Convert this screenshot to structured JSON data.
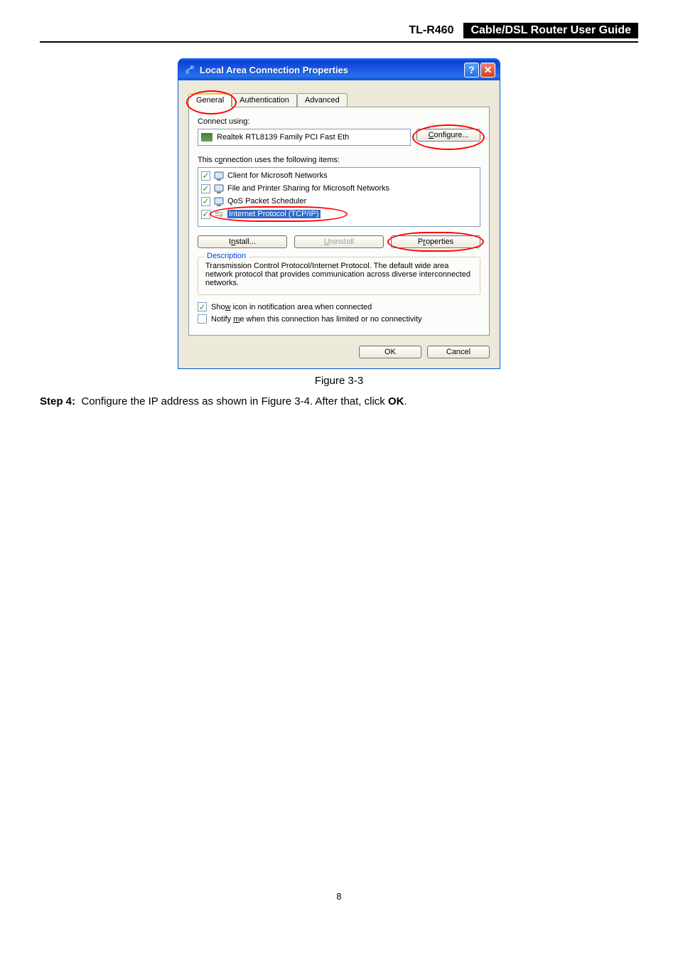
{
  "header": {
    "model": "TL-R460",
    "title": "Cable/DSL Router User Guide"
  },
  "dialog": {
    "title": "Local Area Connection Properties",
    "help_glyph": "?",
    "close_glyph": "✕",
    "tabs": [
      "General",
      "Authentication",
      "Advanced"
    ],
    "connect_label": "Connect using:",
    "adapter": "Realtek RTL8139 Family PCI Fast Eth",
    "configure_btn": "Configure...",
    "conn_items_label": "This connection uses the following items:",
    "items": [
      {
        "checked": true,
        "label": "Client for Microsoft Networks",
        "selected": false
      },
      {
        "checked": true,
        "label": "File and Printer Sharing for Microsoft Networks",
        "selected": false
      },
      {
        "checked": true,
        "label": "QoS Packet Scheduler",
        "selected": false
      },
      {
        "checked": true,
        "label": "Internet Protocol (TCP/IP)",
        "selected": true
      }
    ],
    "install_btn": "Install...",
    "uninstall_btn": "Uninstall",
    "properties_btn": "Properties",
    "desc_title": "Description",
    "desc_text": "Transmission Control Protocol/Internet Protocol. The default wide area network protocol that provides communication across diverse interconnected networks.",
    "show_icon_label": "Show icon in notification area when connected",
    "notify_label": "Notify me when this connection has limited or no connectivity",
    "show_icon_checked": true,
    "notify_checked": false,
    "ok_btn": "OK",
    "cancel_btn": "Cancel"
  },
  "figure_caption": "Figure 3-3",
  "step": {
    "label": "Step 4:",
    "text_before": "Configure the IP address as shown in Figure 3-4. After that, click ",
    "ok": "OK",
    "text_after": "."
  },
  "page_number": "8"
}
